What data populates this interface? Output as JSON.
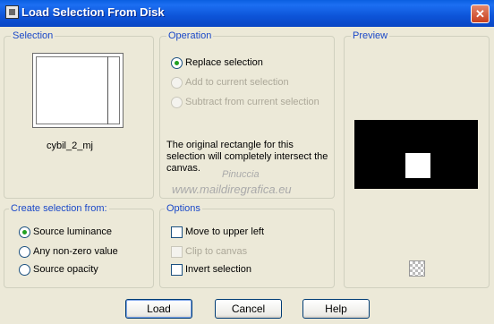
{
  "window": {
    "title": "Load Selection From Disk",
    "close_glyph": "✕"
  },
  "selection": {
    "legend": "Selection",
    "filename": "cybil_2_mj"
  },
  "operation": {
    "legend": "Operation",
    "options": [
      "Replace selection",
      "Add to current selection",
      "Subtract from current selection"
    ],
    "selected": "Replace selection",
    "info": "The original rectangle for this selection will completely intersect the canvas."
  },
  "preview": {
    "legend": "Preview"
  },
  "create_from": {
    "legend": "Create selection from:",
    "options": [
      "Source luminance",
      "Any non-zero value",
      "Source opacity"
    ],
    "selected": "Source luminance"
  },
  "options": {
    "legend": "Options",
    "items": [
      {
        "label": "Move to upper left",
        "checked": false,
        "enabled": true
      },
      {
        "label": "Clip to canvas",
        "checked": false,
        "enabled": false
      },
      {
        "label": "Invert selection",
        "checked": false,
        "enabled": true
      }
    ]
  },
  "watermark": {
    "line1": "Pinuccia",
    "line2": "www.maildiregrafica.eu"
  },
  "buttons": {
    "load": "Load",
    "cancel": "Cancel",
    "help": "Help"
  }
}
